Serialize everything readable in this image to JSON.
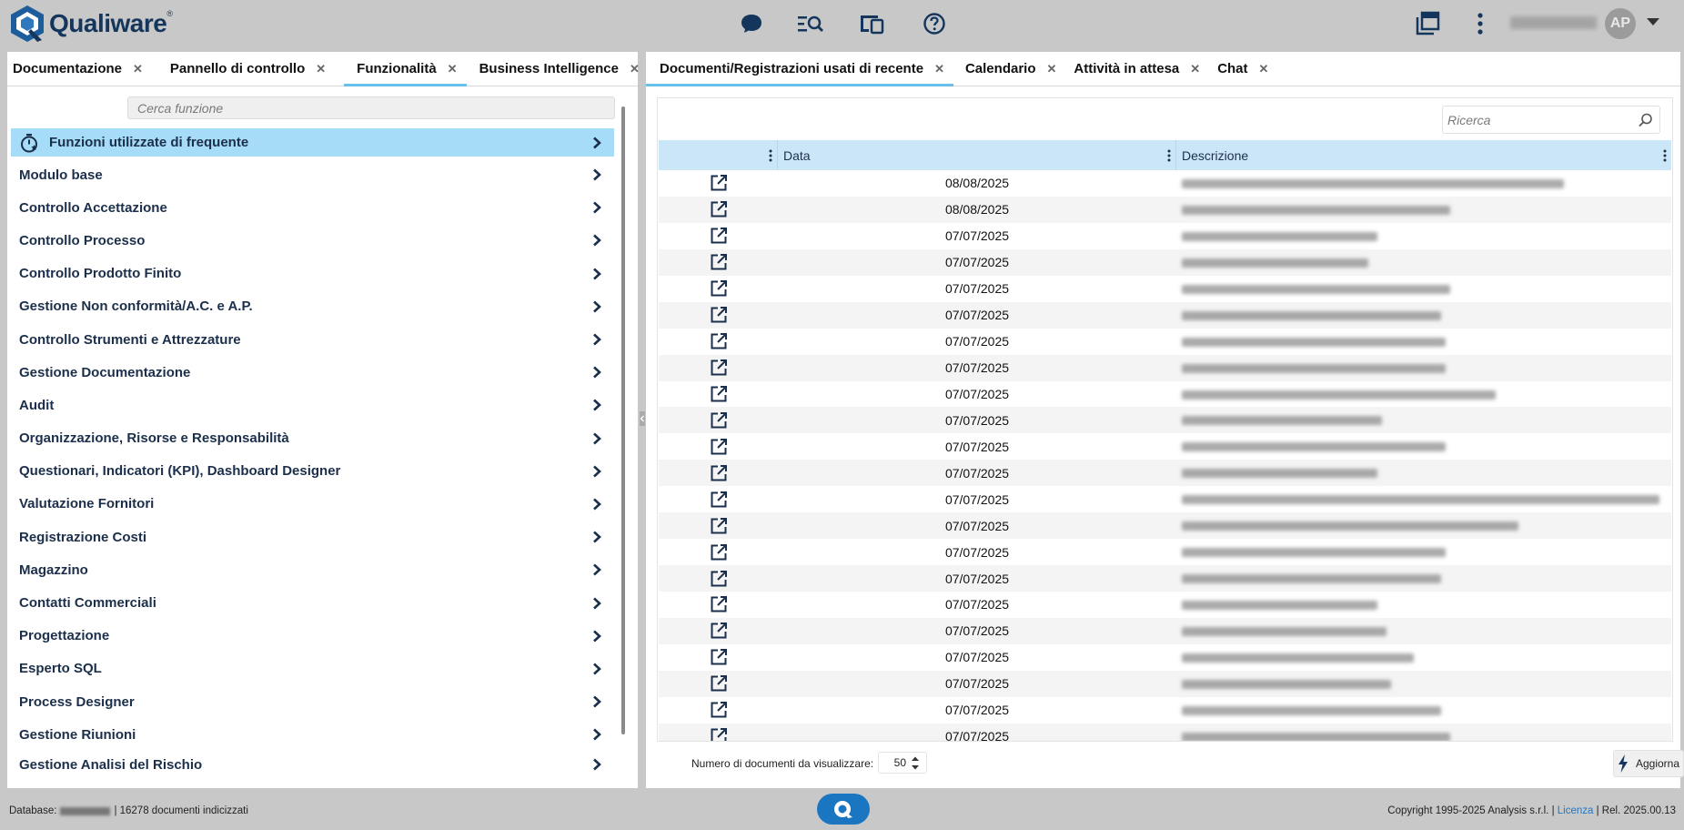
{
  "app": {
    "brand": "Qualiware",
    "brand_mark": "®",
    "user_initials": "AP",
    "accent": "#67c0ea",
    "highlight": "#a6dcf7",
    "brand_blue": "#1b76c2"
  },
  "header_icons": [
    "chat-icon",
    "search-list-icon",
    "devices-icon",
    "help-icon",
    "windows-icon",
    "more-vertical-icon"
  ],
  "left_tabs": [
    {
      "label": "Documentazione",
      "active": false
    },
    {
      "label": "Pannello di controllo",
      "active": false
    },
    {
      "label": "Funzionalità",
      "active": true
    },
    {
      "label": "Business Intelligence",
      "active": false
    }
  ],
  "right_tabs": [
    {
      "label": "Documenti/Registrazioni usati di recente",
      "active": true
    },
    {
      "label": "Calendario",
      "active": false
    },
    {
      "label": "Attività in attesa",
      "active": false
    },
    {
      "label": "Chat",
      "active": false
    }
  ],
  "functions": {
    "search_placeholder": "Cerca funzione",
    "frequent_label": "Funzioni utilizzate di frequente",
    "items": [
      "Modulo base",
      "Controllo Accettazione",
      "Controllo Processo",
      "Controllo Prodotto Finito",
      "Gestione Non conformità/A.C. e A.P.",
      "Controllo Strumenti e Attrezzature",
      "Gestione Documentazione",
      "Audit",
      "Organizzazione, Risorse e Responsabilità",
      "Questionari, Indicatori (KPI), Dashboard Designer",
      "Valutazione Fornitori",
      "Registrazione Costi",
      "Magazzino",
      "Contatti Commerciali",
      "Progettazione",
      "Esperto SQL",
      "Process Designer",
      "Gestione Riunioni",
      "Gestione Analisi del Rischio"
    ]
  },
  "docs": {
    "search_placeholder": "Ricerca",
    "columns": [
      "",
      "Data",
      "Descrizione"
    ],
    "rows": [
      "08/08/2025",
      "08/08/2025",
      "07/07/2025",
      "07/07/2025",
      "07/07/2025",
      "07/07/2025",
      "07/07/2025",
      "07/07/2025",
      "07/07/2025",
      "07/07/2025",
      "07/07/2025",
      "07/07/2025",
      "07/07/2025",
      "07/07/2025",
      "07/07/2025",
      "07/07/2025",
      "07/07/2025",
      "07/07/2025",
      "07/07/2025",
      "07/07/2025",
      "07/07/2025",
      "07/07/2025"
    ],
    "count_label": "Numero di documenti da visualizzare:",
    "count_value": "50",
    "refresh_label": "Aggiorna"
  },
  "status": {
    "db_label": "Database:",
    "db_docs": "16278 documenti indicizzati",
    "copyright": "Copyright 1995-2025 Analysis s.r.l. |",
    "license": "Licenza",
    "release": "| Rel.  2025.00.13"
  }
}
